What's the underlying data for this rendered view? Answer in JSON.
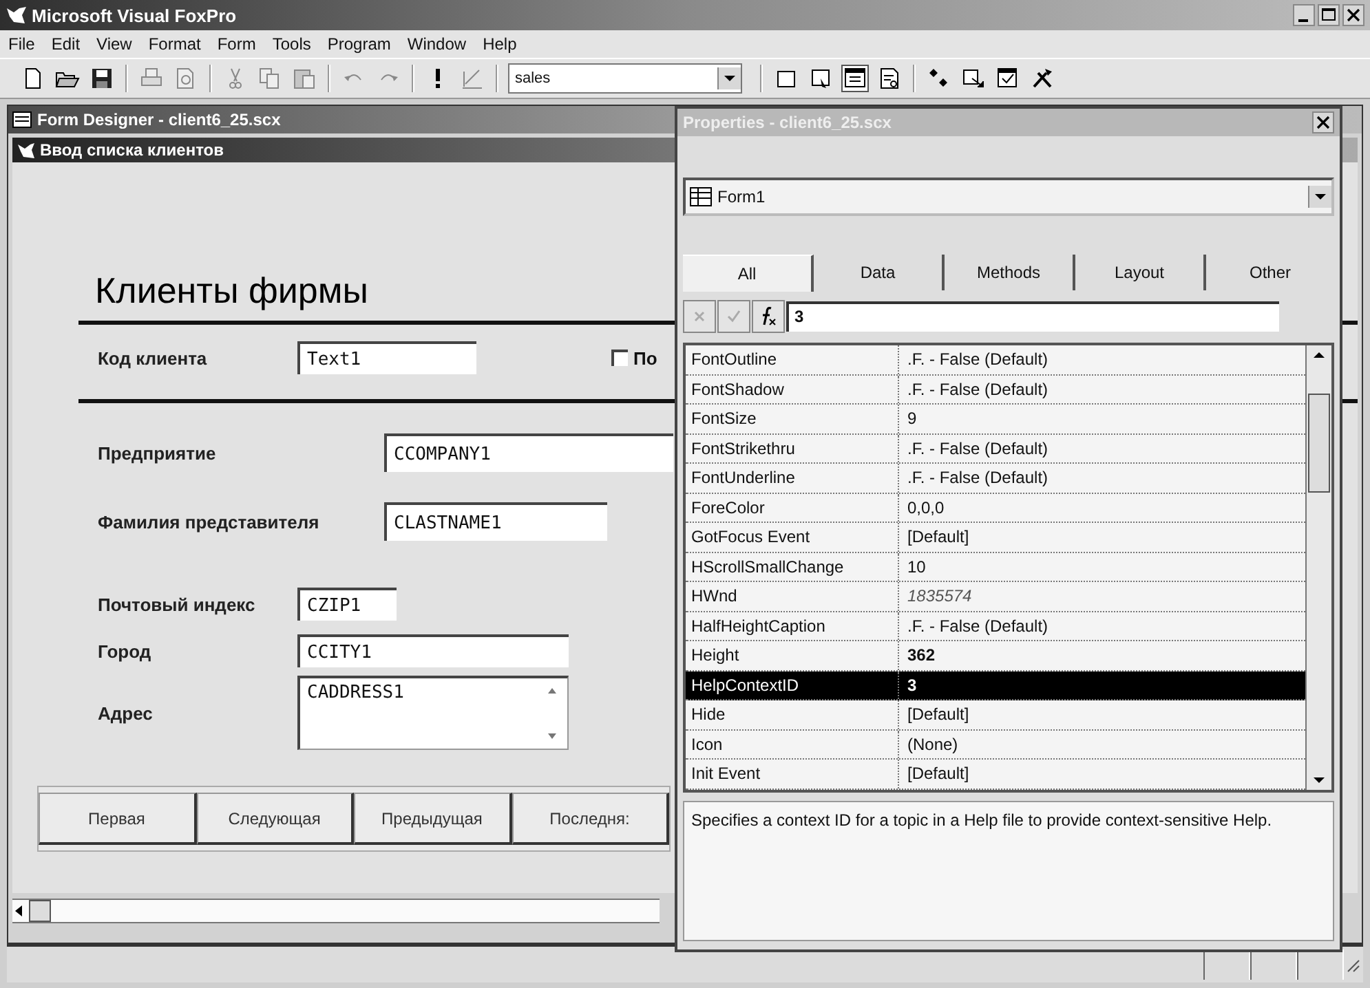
{
  "window": {
    "title": "Microsoft Visual FoxPro"
  },
  "menu": [
    "File",
    "Edit",
    "View",
    "Format",
    "Form",
    "Tools",
    "Program",
    "Window",
    "Help"
  ],
  "toolbar": {
    "left_buttons": [
      {
        "disabled": false
      },
      {
        "disabled": false
      },
      {
        "disabled": false
      },
      {
        "disabled": true
      },
      {
        "disabled": true
      },
      {
        "disabled": true
      },
      {
        "disabled": true
      },
      {
        "disabled": true
      },
      {
        "disabled": true
      },
      {
        "disabled": true
      },
      {
        "disabled": false
      },
      {
        "disabled": true
      }
    ],
    "combo": "sales",
    "right_buttons": [
      {
        "selected": false
      },
      {
        "selected": false
      },
      {
        "selected": true
      },
      {
        "selected": false
      },
      {
        "selected": false
      },
      {
        "selected": false
      },
      {
        "selected": false
      },
      {
        "selected": false
      }
    ]
  },
  "designer": {
    "title": "Form Designer - client6_25.scx",
    "form": {
      "caption": "Ввод списка клиентов",
      "heading": "Клиенты фирмы",
      "code_label": "Код клиента",
      "code_field": "Text1",
      "checkbox": {
        "label": "По",
        "checked": false
      },
      "fields": [
        {
          "kind": "company",
          "label": "Предприятие",
          "value": "CCOMPANY1"
        },
        {
          "kind": "lastname",
          "label": "Фамилия представителя",
          "value": "CLASTNAME1"
        },
        {
          "kind": "zip",
          "label": "Почтовый индекс",
          "value": "CZIP1"
        },
        {
          "kind": "city",
          "label": "Город",
          "value": "CCITY1"
        },
        {
          "kind": "memo",
          "label": "Адрес",
          "value": "CADDRESS1"
        }
      ],
      "buttons": [
        "Первая",
        "Следующая",
        "Предыдущая",
        "Последня:"
      ]
    }
  },
  "properties": {
    "title": "Properties - client6_25.scx",
    "object": "Form1",
    "tabs": [
      {
        "label": "All",
        "selected": true
      },
      {
        "label": "Data",
        "selected": false
      },
      {
        "label": "Methods",
        "selected": false
      },
      {
        "label": "Layout",
        "selected": false
      },
      {
        "label": "Other",
        "selected": false
      }
    ],
    "edit_value": "3",
    "rows": [
      {
        "name": "FontOutline",
        "value": ".F. - False (Default)",
        "kind": "normal",
        "selected": false
      },
      {
        "name": "FontShadow",
        "value": ".F. - False (Default)",
        "kind": "normal",
        "selected": false
      },
      {
        "name": "FontSize",
        "value": "9",
        "kind": "normal",
        "selected": false
      },
      {
        "name": "FontStrikethru",
        "value": ".F. - False (Default)",
        "kind": "normal",
        "selected": false
      },
      {
        "name": "FontUnderline",
        "value": ".F. - False (Default)",
        "kind": "normal",
        "selected": false
      },
      {
        "name": "ForeColor",
        "value": "0,0,0",
        "kind": "normal",
        "selected": false
      },
      {
        "name": "GotFocus Event",
        "value": "[Default]",
        "kind": "normal",
        "selected": false
      },
      {
        "name": "HScrollSmallChange",
        "value": "10",
        "kind": "normal",
        "selected": false
      },
      {
        "name": "HWnd",
        "value": "1835574",
        "kind": "readonly",
        "selected": false
      },
      {
        "name": "HalfHeightCaption",
        "value": ".F. - False (Default)",
        "kind": "normal",
        "selected": false
      },
      {
        "name": "Height",
        "value": "362",
        "kind": "modified",
        "selected": false
      },
      {
        "name": "HelpContextID",
        "value": "3",
        "kind": "modified",
        "selected": true
      },
      {
        "name": "Hide",
        "value": "[Default]",
        "kind": "normal",
        "selected": false
      },
      {
        "name": "Icon",
        "value": "(None)",
        "kind": "normal",
        "selected": false
      },
      {
        "name": "Init Event",
        "value": "[Default]",
        "kind": "normal",
        "selected": false
      }
    ],
    "description": "Specifies a context ID for a topic in a Help file to provide context-sensitive Help."
  }
}
